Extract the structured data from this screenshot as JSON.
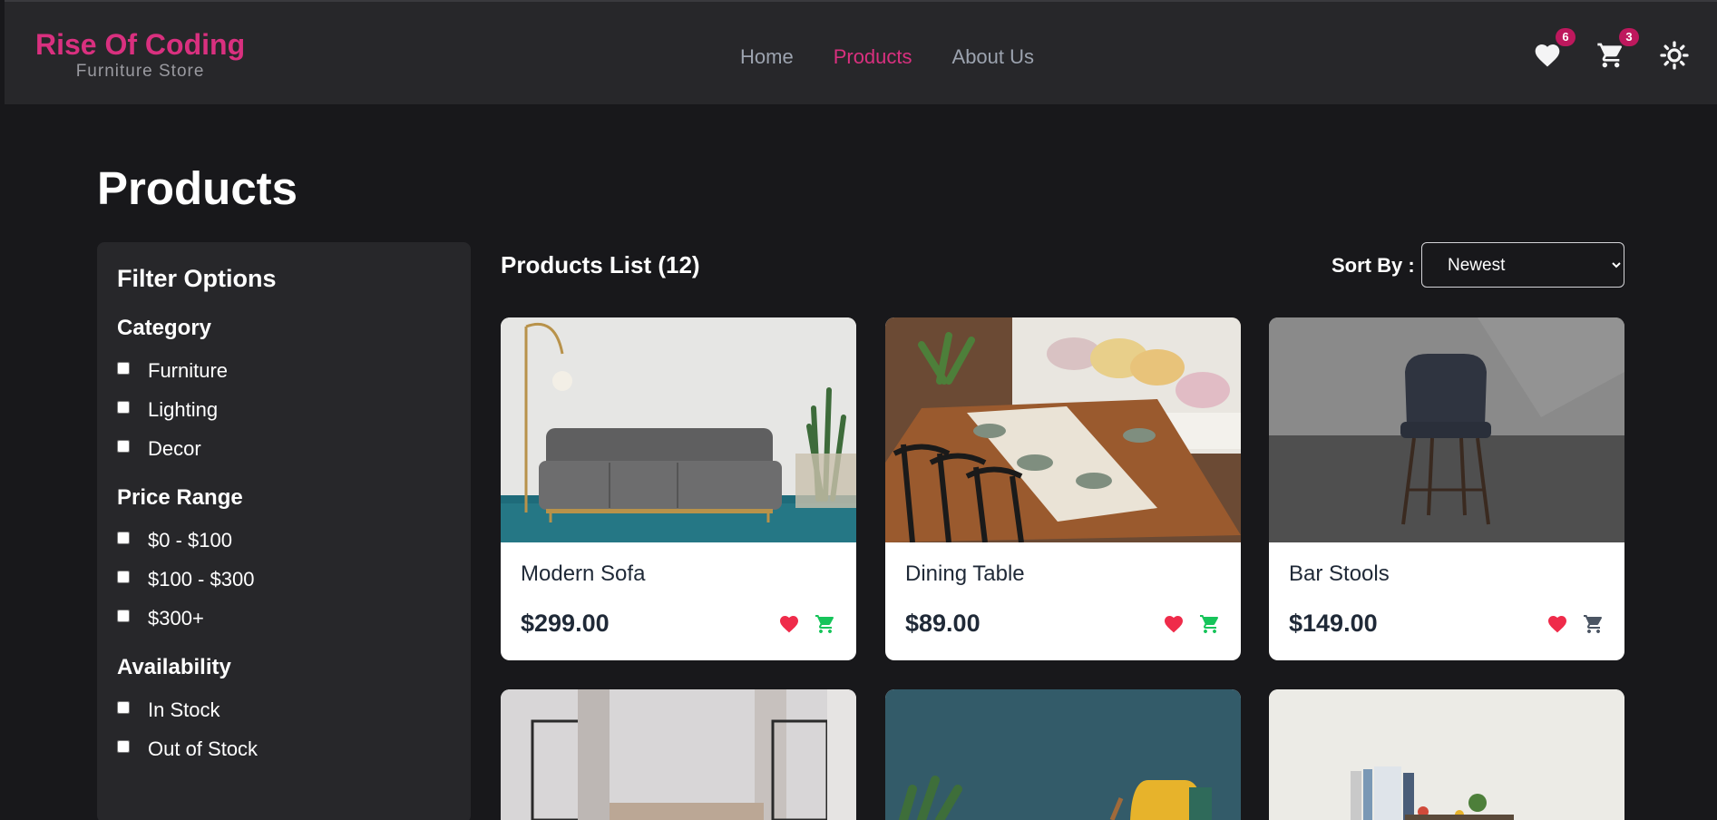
{
  "brand": {
    "title": "Rise Of Coding",
    "subtitle": "Furniture Store"
  },
  "nav": {
    "links": [
      {
        "label": "Home",
        "active": false
      },
      {
        "label": "Products",
        "active": true
      },
      {
        "label": "About Us",
        "active": false
      }
    ],
    "wishlist_count": "6",
    "cart_count": "3",
    "icons": [
      "heart-icon",
      "cart-icon",
      "sun-icon"
    ]
  },
  "page": {
    "title": "Products"
  },
  "filters": {
    "title": "Filter Options",
    "category": {
      "title": "Category",
      "options": [
        "Furniture",
        "Lighting",
        "Decor"
      ]
    },
    "price": {
      "title": "Price Range",
      "options": [
        "$0 - $100",
        "$100 - $300",
        "$300+"
      ]
    },
    "availability": {
      "title": "Availability",
      "options": [
        "In Stock",
        "Out of Stock"
      ]
    }
  },
  "products": {
    "list_title": "Products List (12)",
    "sort_label": "Sort By :",
    "sort_value": "Newest",
    "items": [
      {
        "name": "Modern Sofa",
        "price": "$299.00",
        "in_cart": true
      },
      {
        "name": "Dining Table",
        "price": "$89.00",
        "in_cart": true
      },
      {
        "name": "Bar Stools",
        "price": "$149.00",
        "in_cart": false
      }
    ]
  },
  "colors": {
    "accent": "#d9307f",
    "heart": "#ef2b4a",
    "cart_added": "#16c45a",
    "cart_default": "#4b5563"
  }
}
